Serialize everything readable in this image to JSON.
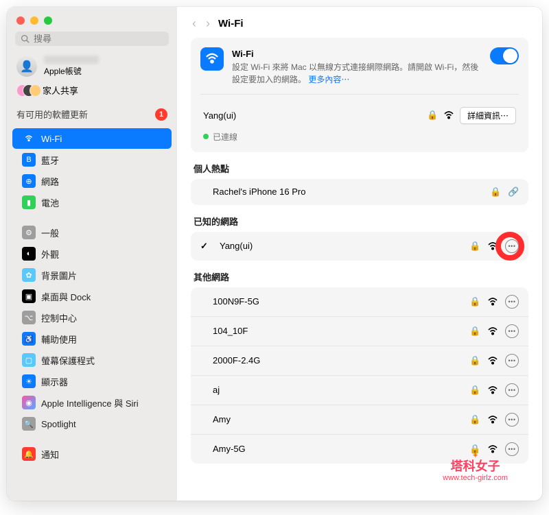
{
  "search": {
    "placeholder": "搜尋"
  },
  "account": {
    "sub": "Apple帳號"
  },
  "family": {
    "label": "家人共享"
  },
  "update": {
    "label": "有可用的軟體更新",
    "count": "1"
  },
  "sidebar": {
    "items": [
      {
        "label": "Wi-Fi"
      },
      {
        "label": "藍牙"
      },
      {
        "label": "網路"
      },
      {
        "label": "電池"
      },
      {
        "label": "一般"
      },
      {
        "label": "外觀"
      },
      {
        "label": "背景圖片"
      },
      {
        "label": "桌面與 Dock"
      },
      {
        "label": "控制中心"
      },
      {
        "label": "輔助使用"
      },
      {
        "label": "螢幕保護程式"
      },
      {
        "label": "顯示器"
      },
      {
        "label": "Apple Intelligence 與 Siri"
      },
      {
        "label": "Spotlight"
      },
      {
        "label": "通知"
      }
    ]
  },
  "header": {
    "title": "Wi-Fi"
  },
  "wifi_card": {
    "title": "Wi-Fi",
    "desc": "設定 Wi-Fi 來將 Mac 以無線方式連接網際網路。請開啟 Wi-Fi，然後設定要加入的網路。",
    "more": "更多內容⋯"
  },
  "current": {
    "name": "Yang(ui)",
    "status": "已連線",
    "details_btn": "詳細資訊⋯"
  },
  "sections": {
    "hotspot": "個人熱點",
    "known": "已知的網路",
    "other": "其他網路"
  },
  "hotspot": {
    "items": [
      {
        "name": "Rachel's iPhone 16 Pro"
      }
    ]
  },
  "known": {
    "items": [
      {
        "name": "Yang(ui)"
      }
    ]
  },
  "other": {
    "items": [
      {
        "name": "100N9F-5G"
      },
      {
        "name": "104_10F"
      },
      {
        "name": "2000F-2.4G"
      },
      {
        "name": "aj"
      },
      {
        "name": "Amy"
      },
      {
        "name": "Amy-5G"
      }
    ]
  },
  "watermark": {
    "title": "塔科女子",
    "sub": "www.tech-girlz.com"
  }
}
